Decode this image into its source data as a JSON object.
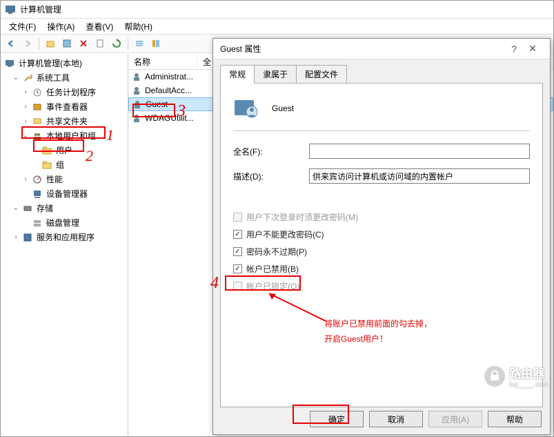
{
  "window": {
    "title": "计算机管理"
  },
  "menu": {
    "file": "文件(F)",
    "action": "操作(A)",
    "view": "查看(V)",
    "help": "帮助(H)"
  },
  "tree": {
    "root": "计算机管理(本地)",
    "system_tools": "系统工具",
    "task_scheduler": "任务计划程序",
    "event_viewer": "事件查看器",
    "shared_folders": "共享文件夹",
    "local_users": "本地用户和组",
    "users": "用户",
    "groups": "组",
    "performance": "性能",
    "device_manager": "设备管理器",
    "storage": "存储",
    "disk_mgmt": "磁盘管理",
    "services_apps": "服务和应用程序"
  },
  "list": {
    "col_name": "名称",
    "col_full": "全",
    "rows": {
      "admin": "Administrat...",
      "default": "DefaultAcc...",
      "guest": "Guest",
      "wdag": "WDAGUtilit..."
    }
  },
  "dialog": {
    "title": "Guest 属性",
    "tabs": {
      "general": "常规",
      "memberof": "隶属于",
      "profile": "配置文件"
    },
    "username": "Guest",
    "fullname_label": "全名(F):",
    "fullname_value": "",
    "desc_label": "描述(D):",
    "desc_value": "供来宾访问计算机或访问域的内置帐户",
    "chk_change_next": "用户下次登录时须更改密码(M)",
    "chk_cannot_change": "用户不能更改密码(C)",
    "chk_never_expires": "密码永不过期(P)",
    "chk_disabled": "帐户已禁用(B)",
    "chk_locked": "帐户已锁定(O)",
    "btn_ok": "确定",
    "btn_cancel": "取消",
    "btn_apply": "应用(A)",
    "btn_help": "帮助"
  },
  "annotations": {
    "n1": "1",
    "n2": "2",
    "n3": "3",
    "n4": "4",
    "note_line1": "将账户已禁用前面的勾去掉，",
    "note_line2": "开启Guest用户！"
  },
  "watermark": {
    "main": "路由器",
    "sub": "luy____.com"
  }
}
